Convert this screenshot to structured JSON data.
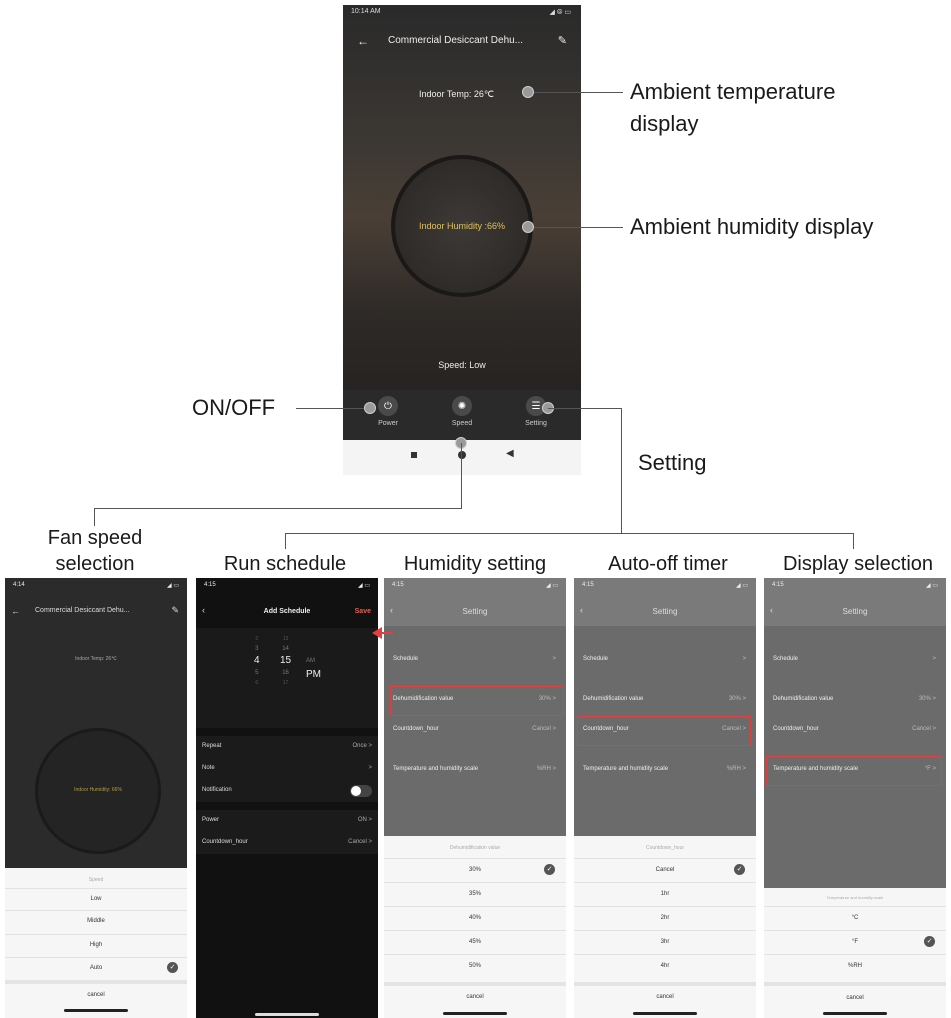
{
  "callouts": {
    "temperature": "Ambient temperature display",
    "temperature_line1": "Ambient temperature",
    "temperature_line2": "display",
    "humidity": "Ambient humidity display",
    "onoff": "ON/OFF",
    "setting": "Setting"
  },
  "captions": {
    "fan_line1": "Fan speed",
    "fan_line2": "selection",
    "run": "Run schedule",
    "humidity": "Humidity setting",
    "autooff": "Auto-off timer",
    "display": "Display selection"
  },
  "main_phone": {
    "time": "10:14 AM",
    "status_icons": "◢ ⦾ ▭",
    "back_icon": "arrow-left-icon",
    "title": "Commercial Desiccant Dehu...",
    "edit_icon": "pencil-icon",
    "indoor_temp": "Indoor Temp: 26℃",
    "indoor_humidity": "Indoor Humidity :66%",
    "speed": "Speed: Low",
    "toolbar": [
      {
        "label": "Power",
        "icon": "power-icon"
      },
      {
        "label": "Speed",
        "icon": "fan-icon"
      },
      {
        "label": "Setting",
        "icon": "settings-icon"
      }
    ]
  },
  "phone_fan": {
    "time": "4:14",
    "title": "Commercial Desiccant Dehu...",
    "indoor_temp": "Indoor Temp: 26℃",
    "indoor_humidity": "Indoor Humidity: 66%",
    "sheet_title": "Speed",
    "options": [
      "Low",
      "Middle",
      "High",
      "Auto"
    ],
    "selected": "Auto",
    "cancel": "cancel"
  },
  "phone_schedule": {
    "time": "4:15",
    "title": "Add Schedule",
    "save": "Save",
    "picker_hours": [
      "2",
      "3",
      "4",
      "5",
      "6"
    ],
    "picker_minutes": [
      "13",
      "14",
      "15",
      "16",
      "17"
    ],
    "picker_ampm": [
      "AM",
      "PM"
    ],
    "rows": [
      {
        "label": "Repeat",
        "value": "Once >"
      },
      {
        "label": "Note",
        "value": ">"
      },
      {
        "label": "Notification",
        "value": ""
      },
      {
        "label": "Power",
        "value": "ON >"
      },
      {
        "label": "Countdown_hour",
        "value": "Cancel >"
      }
    ]
  },
  "phone_humidity": {
    "time": "4:15",
    "title": "Setting",
    "rows": [
      {
        "label": "Schedule",
        "value": ">"
      },
      {
        "label": "Dehumidification value",
        "value": "30% >"
      },
      {
        "label": "Countdown_hour",
        "value": "Cancel >"
      },
      {
        "label": "Temperature and humidity scale",
        "value": "%RH >"
      }
    ],
    "sheet_title": "Dehumidification value",
    "options": [
      "30%",
      "35%",
      "40%",
      "45%",
      "50%"
    ],
    "selected": "30%",
    "cancel": "cancel"
  },
  "phone_autooff": {
    "time": "4:15",
    "title": "Setting",
    "rows": [
      {
        "label": "Schedule",
        "value": ">"
      },
      {
        "label": "Dehumidification value",
        "value": "30% >"
      },
      {
        "label": "Countdown_hour",
        "value": "Cancel >"
      },
      {
        "label": "Temperature and humidity scale",
        "value": "%RH >"
      }
    ],
    "sheet_title": "Countdown_hour",
    "options": [
      "Cancel",
      "1hr",
      "2hr",
      "3hr",
      "4hr"
    ],
    "selected": "Cancel",
    "cancel": "cancel"
  },
  "phone_display": {
    "time": "4:15",
    "title": "Setting",
    "rows": [
      {
        "label": "Schedule",
        "value": ">"
      },
      {
        "label": "Dehumidification value",
        "value": "30% >"
      },
      {
        "label": "Countdown_hour",
        "value": "Cancel >"
      },
      {
        "label": "Temperature and humidity scale",
        "value": "°F >"
      }
    ],
    "sheet_title": "Temperature and humidity scale",
    "options": [
      "°C",
      "°F",
      "%RH"
    ],
    "selected": "°F",
    "cancel": "cancel"
  },
  "colors": {
    "highlight": "#e04040",
    "humidity_text": "#e0c35a",
    "save": "#e8604a"
  }
}
